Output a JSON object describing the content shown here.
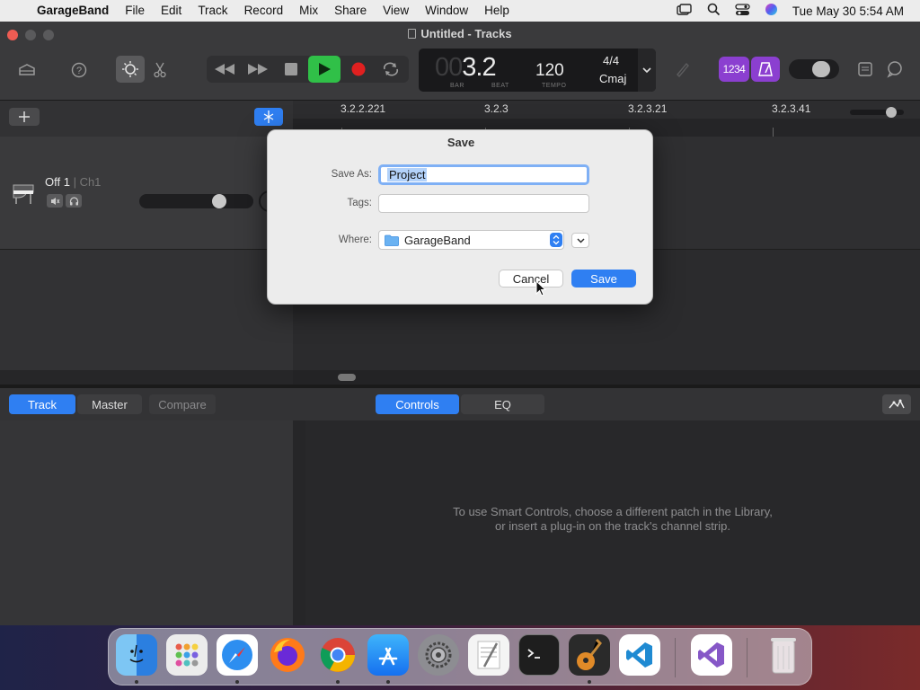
{
  "menubar": {
    "app_name": "GarageBand",
    "items": [
      "File",
      "Edit",
      "Track",
      "Record",
      "Mix",
      "Share",
      "View",
      "Window",
      "Help"
    ],
    "datetime": "Tue May 30  5:54 AM"
  },
  "window": {
    "title": "Untitled - Tracks"
  },
  "lcd": {
    "position": "3.2",
    "position_dim": "00",
    "bar_label": "BAR",
    "beat_label": "BEAT",
    "tempo": "120",
    "tempo_label": "TEMPO",
    "time_signature": "4/4",
    "key": "Cmaj"
  },
  "toolbar": {
    "count_in_label": "1234"
  },
  "ruler": {
    "markers": [
      "3.2.2.221",
      "3.2.3",
      "3.2.3.21",
      "3.2.3.41"
    ]
  },
  "track": {
    "name": "Off 1",
    "channel": "Ch1"
  },
  "bottom": {
    "tabs": [
      "Track",
      "Master",
      "Compare"
    ],
    "active_tab": "Track",
    "view_tabs": [
      "Controls",
      "EQ"
    ],
    "active_view_tab": "Controls",
    "message_line1": "To use Smart Controls, choose a different patch in the Library,",
    "message_line2": "or insert a plug-in on the track's channel strip."
  },
  "dialog": {
    "title": "Save",
    "save_as_label": "Save As:",
    "save_as_value": "Project",
    "tags_label": "Tags:",
    "tags_value": "",
    "where_label": "Where:",
    "where_value": "GarageBand",
    "cancel_label": "Cancel",
    "save_label": "Save"
  },
  "colors": {
    "accent": "#2f7ff2",
    "play": "#30c048",
    "record": "#e02020",
    "purple": "#8b3fd0"
  },
  "dock": {
    "apps": [
      "finder-icon",
      "launchpad-icon",
      "safari-icon",
      "firefox-icon",
      "chrome-icon",
      "app-store-icon",
      "system-settings-icon",
      "textedit-icon",
      "terminal-icon",
      "garageband-icon",
      "vscode-icon",
      "visual-studio-icon",
      "trash-icon"
    ]
  }
}
